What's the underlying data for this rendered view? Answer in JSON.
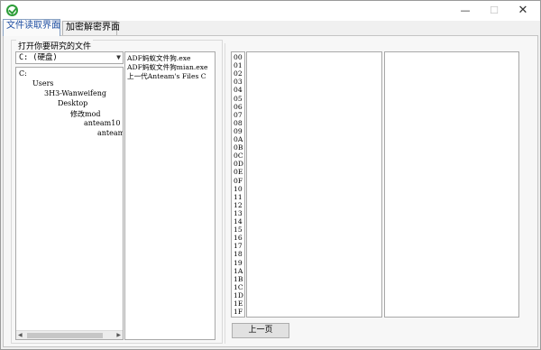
{
  "window": {
    "minimize_glyph": "—",
    "maximize_glyph": "☐",
    "close_glyph": "✕"
  },
  "tabs": [
    {
      "label": "文件读取界面",
      "active": true
    },
    {
      "label": "加密解密界面",
      "active": false
    }
  ],
  "file_panel": {
    "group_label": "打开你要研究的文件",
    "drive": {
      "selected": "C: (硬盘)"
    },
    "tree": [
      "C:",
      "Users",
      "3H3-Wanweifeng",
      "Desktop",
      "修改mod",
      "anteam10",
      "anteam"
    ],
    "files": [
      "ADF蚂蚁文件狗.exe",
      "ADF蚂蚁文件狗mian.exe",
      "上一代Anteam's Files C"
    ]
  },
  "hex_viewer": {
    "addresses": [
      "00",
      "01",
      "02",
      "03",
      "04",
      "05",
      "06",
      "07",
      "08",
      "09",
      "0A",
      "0B",
      "0C",
      "0D",
      "0E",
      "0F",
      "10",
      "11",
      "12",
      "13",
      "14",
      "15",
      "16",
      "17",
      "18",
      "19",
      "1A",
      "1B",
      "1C",
      "1D",
      "1E",
      "1F"
    ],
    "prev_button": "上一页"
  },
  "colors": {
    "active_tab_text": "#1f4fa3",
    "app_icon": "#2e9e3a"
  },
  "icons": [
    "app-logo-icon",
    "chevron-down-icon",
    "scroll-left-arrow-icon",
    "scroll-right-arrow-icon"
  ]
}
